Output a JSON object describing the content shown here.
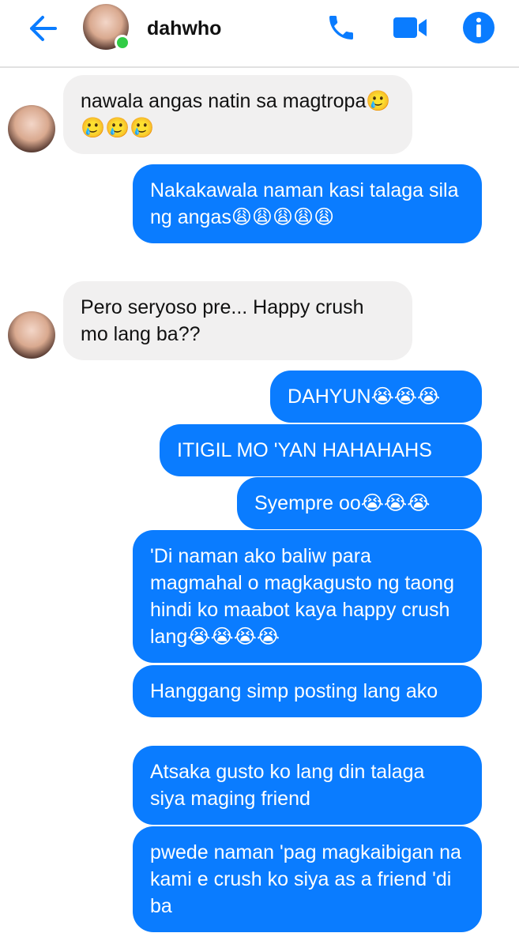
{
  "header": {
    "contact_name": "dahwho",
    "icons": {
      "back": "back-arrow-icon",
      "call": "phone-icon",
      "video": "video-camera-icon",
      "info": "info-icon"
    },
    "accent_color": "#0a7cff",
    "online_color": "#31cc46"
  },
  "messages": [
    {
      "sender": "contact",
      "text": "nawala angas natin sa magtropa🥲🥲🥲🥲"
    },
    {
      "sender": "me",
      "text": "Nakakawala naman kasi talaga sila ng angas😩😩😩😩😩"
    },
    {
      "sender": "contact",
      "text": "Pero seryoso pre... Happy crush mo lang ba??"
    },
    {
      "sender": "me",
      "text": "DAHYUN😭😭😭"
    },
    {
      "sender": "me",
      "text": "ITIGIL MO 'YAN HAHAHAHS"
    },
    {
      "sender": "me",
      "text": "Syempre oo😭😭😭"
    },
    {
      "sender": "me",
      "text": "'Di naman ako baliw para magmahal o magkagusto ng taong hindi ko maabot kaya happy crush lang😭😭😭😭"
    },
    {
      "sender": "me",
      "text": "Hanggang simp posting lang ako"
    },
    {
      "sender": "me",
      "text": "Atsaka gusto ko lang din talaga siya maging friend"
    },
    {
      "sender": "me",
      "text": "pwede naman 'pag magkaibigan na kami e crush ko siya as a friend 'di ba"
    }
  ]
}
